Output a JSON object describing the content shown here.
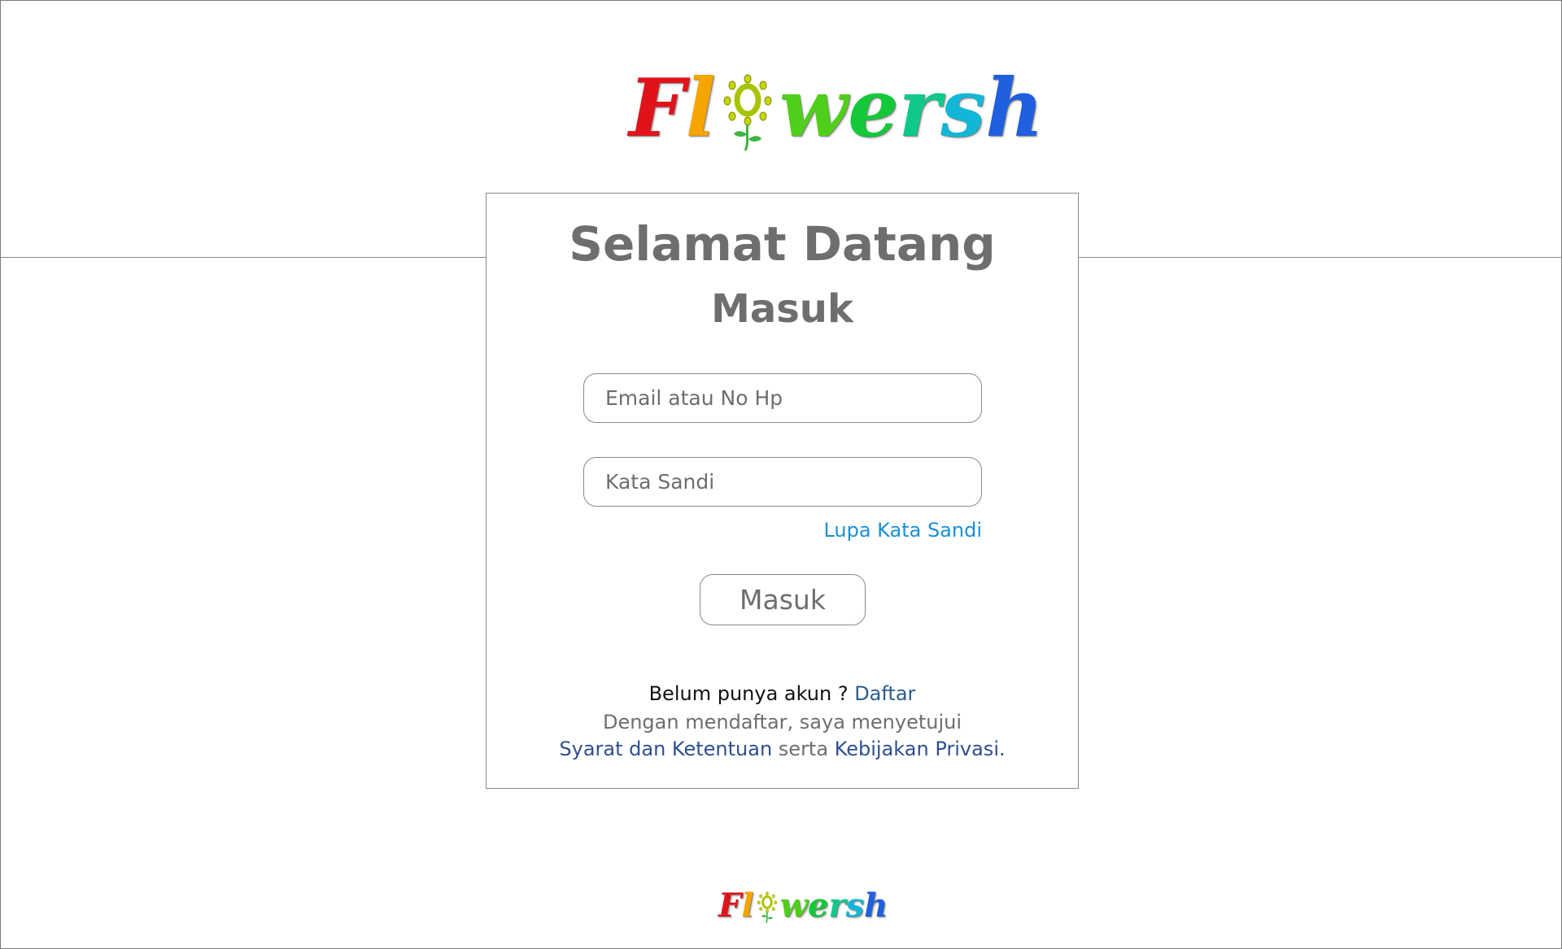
{
  "logo": {
    "text": "Flowersh",
    "letters": [
      {
        "char": "F",
        "color": "#e0131b"
      },
      {
        "char": "l",
        "color": "#f5a400"
      },
      {
        "char": "o",
        "color": "#b7d600"
      },
      {
        "char": "w",
        "color": "#4fcf1a"
      },
      {
        "char": "e",
        "color": "#15c83a"
      },
      {
        "char": "r",
        "color": "#0fc98a"
      },
      {
        "char": "s",
        "color": "#12b6d6"
      },
      {
        "char": "h",
        "color": "#1f5fe0"
      }
    ]
  },
  "card": {
    "welcome": "Selamat Datang",
    "title": "Masuk",
    "email_placeholder": "Email atau No Hp",
    "password_placeholder": "Kata Sandi",
    "forgot_label": "Lupa Kata Sandi",
    "login_label": "Masuk",
    "signup_prompt": "Belum punya akun ?",
    "signup_link": "Daftar",
    "terms_prefix": "Dengan mendaftar, saya menyetujui",
    "terms_link": "Syarat dan Ketentuan",
    "terms_joiner": "serta",
    "privacy_link": "Kebijakan Privasi."
  },
  "colors": {
    "link_blue": "#1b8fd6",
    "link_dark": "#2a5c8f",
    "heading_gray": "#6e6e6e"
  }
}
